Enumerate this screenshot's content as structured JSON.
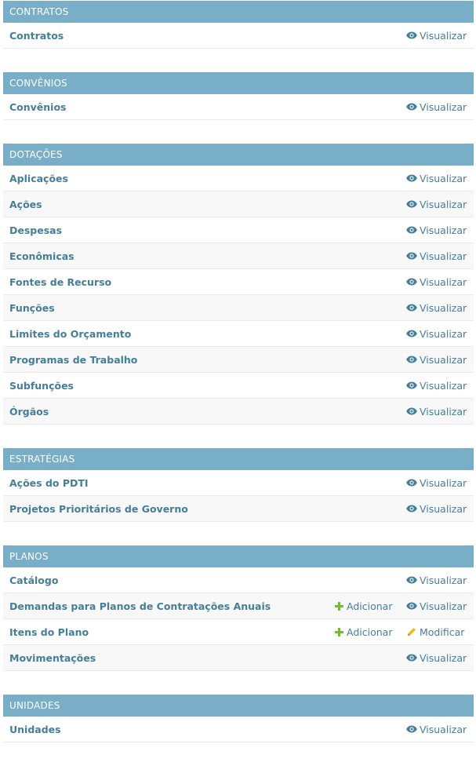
{
  "colors": {
    "header_bg": "#79aec8",
    "link": "#447e9b",
    "add_icon": "#70bf2b",
    "change_icon": "#efb80b"
  },
  "modules": [
    {
      "title": "CONTRATOS",
      "rows": [
        {
          "label": "Contratos",
          "actions": [
            {
              "type": "view",
              "label": "Visualizar",
              "icon": "eye-icon"
            }
          ]
        }
      ]
    },
    {
      "title": "CONVÊNIOS",
      "rows": [
        {
          "label": "Convênios",
          "actions": [
            {
              "type": "view",
              "label": "Visualizar",
              "icon": "eye-icon"
            }
          ]
        }
      ]
    },
    {
      "title": "DOTAÇÕES",
      "rows": [
        {
          "label": "Aplicações",
          "actions": [
            {
              "type": "view",
              "label": "Visualizar",
              "icon": "eye-icon"
            }
          ]
        },
        {
          "label": "Ações",
          "actions": [
            {
              "type": "view",
              "label": "Visualizar",
              "icon": "eye-icon"
            }
          ]
        },
        {
          "label": "Despesas",
          "actions": [
            {
              "type": "view",
              "label": "Visualizar",
              "icon": "eye-icon"
            }
          ]
        },
        {
          "label": "Econômicas",
          "actions": [
            {
              "type": "view",
              "label": "Visualizar",
              "icon": "eye-icon"
            }
          ]
        },
        {
          "label": "Fontes de Recurso",
          "actions": [
            {
              "type": "view",
              "label": "Visualizar",
              "icon": "eye-icon"
            }
          ]
        },
        {
          "label": "Funções",
          "actions": [
            {
              "type": "view",
              "label": "Visualizar",
              "icon": "eye-icon"
            }
          ]
        },
        {
          "label": "Limites do Orçamento",
          "actions": [
            {
              "type": "view",
              "label": "Visualizar",
              "icon": "eye-icon"
            }
          ]
        },
        {
          "label": "Programas de Trabalho",
          "actions": [
            {
              "type": "view",
              "label": "Visualizar",
              "icon": "eye-icon"
            }
          ]
        },
        {
          "label": "Subfunções",
          "actions": [
            {
              "type": "view",
              "label": "Visualizar",
              "icon": "eye-icon"
            }
          ]
        },
        {
          "label": "Órgãos",
          "actions": [
            {
              "type": "view",
              "label": "Visualizar",
              "icon": "eye-icon"
            }
          ]
        }
      ]
    },
    {
      "title": "ESTRATÉGIAS",
      "rows": [
        {
          "label": "Ações do PDTI",
          "actions": [
            {
              "type": "view",
              "label": "Visualizar",
              "icon": "eye-icon"
            }
          ]
        },
        {
          "label": "Projetos Prioritários de Governo",
          "actions": [
            {
              "type": "view",
              "label": "Visualizar",
              "icon": "eye-icon"
            }
          ]
        }
      ]
    },
    {
      "title": "PLANOS",
      "rows": [
        {
          "label": "Catálogo",
          "actions": [
            {
              "type": "view",
              "label": "Visualizar",
              "icon": "eye-icon"
            }
          ]
        },
        {
          "label": "Demandas para Planos de Contratações Anuais",
          "actions": [
            {
              "type": "add",
              "label": "Adicionar",
              "icon": "plus-icon"
            },
            {
              "type": "view",
              "label": "Visualizar",
              "icon": "eye-icon"
            }
          ]
        },
        {
          "label": "Itens do Plano",
          "actions": [
            {
              "type": "add",
              "label": "Adicionar",
              "icon": "plus-icon"
            },
            {
              "type": "change",
              "label": "Modificar",
              "icon": "pencil-icon"
            }
          ]
        },
        {
          "label": "Movimentações",
          "actions": [
            {
              "type": "view",
              "label": "Visualizar",
              "icon": "eye-icon"
            }
          ]
        }
      ]
    },
    {
      "title": "UNIDADES",
      "rows": [
        {
          "label": "Unidades",
          "actions": [
            {
              "type": "view",
              "label": "Visualizar",
              "icon": "eye-icon"
            }
          ]
        }
      ]
    }
  ]
}
